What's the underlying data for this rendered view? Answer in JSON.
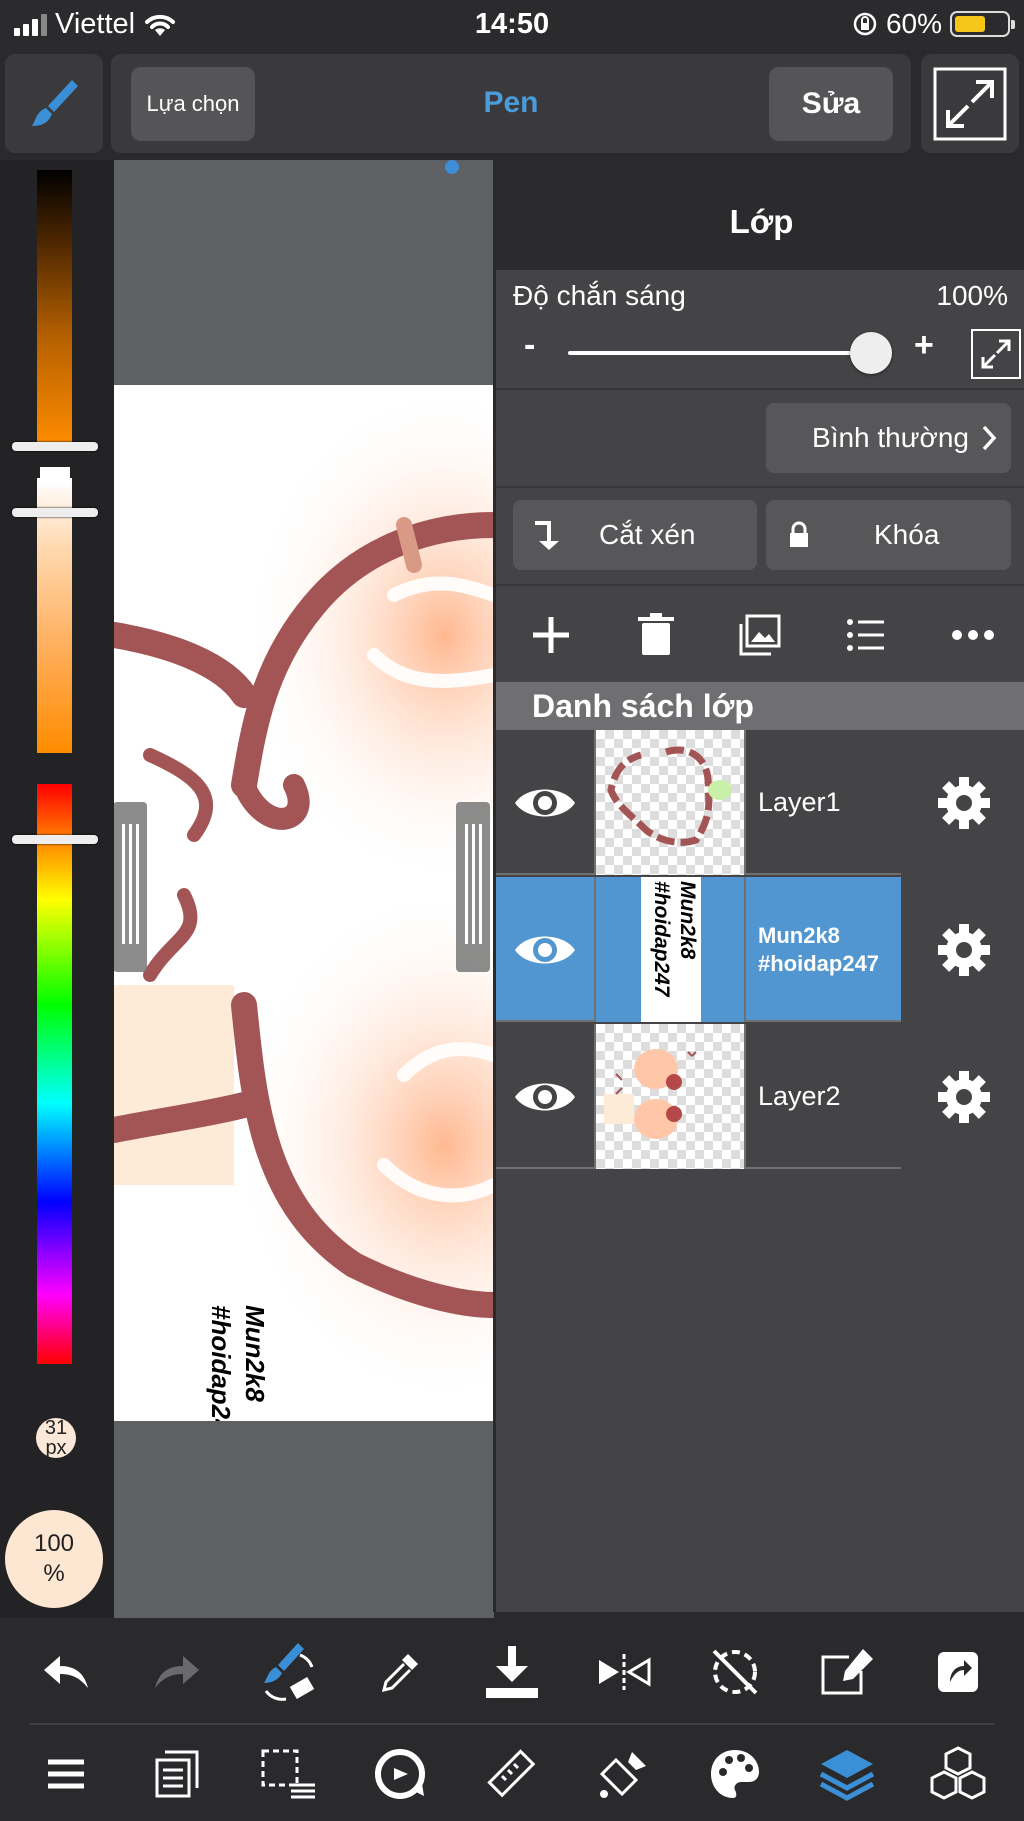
{
  "status_bar": {
    "carrier": "Viettel",
    "time": "14:50",
    "battery": "60%",
    "battery_level": 0.6
  },
  "top_toolbar": {
    "select_label": "Lựa chọn",
    "tool_name": "Pen",
    "edit_label": "Sửa"
  },
  "left_panel": {
    "brush_size_value": "31",
    "brush_size_unit": "px",
    "opacity_value": "100",
    "opacity_unit": "%"
  },
  "canvas": {
    "watermark_line1": "Mun2k8",
    "watermark_line2": "#hoidap247"
  },
  "layer_panel": {
    "title": "Lớp",
    "opacity_label": "Độ chắn sáng",
    "opacity_value": "100%",
    "opacity_level": 1.0,
    "minus": "-",
    "plus": "+",
    "blend_mode": "Bình thường",
    "clip_label": "Cắt xén",
    "lock_label": "Khóa",
    "list_title": "Danh sách lớp",
    "layers": [
      {
        "name": "Layer1",
        "selected": false
      },
      {
        "name": "Mun2k8\n#hoidap247",
        "selected": true
      },
      {
        "name": "Layer2",
        "selected": false
      }
    ]
  },
  "colors": {
    "accent": "#4a9bd9",
    "selected_row": "#5196d0",
    "stroke": "#a35555"
  }
}
